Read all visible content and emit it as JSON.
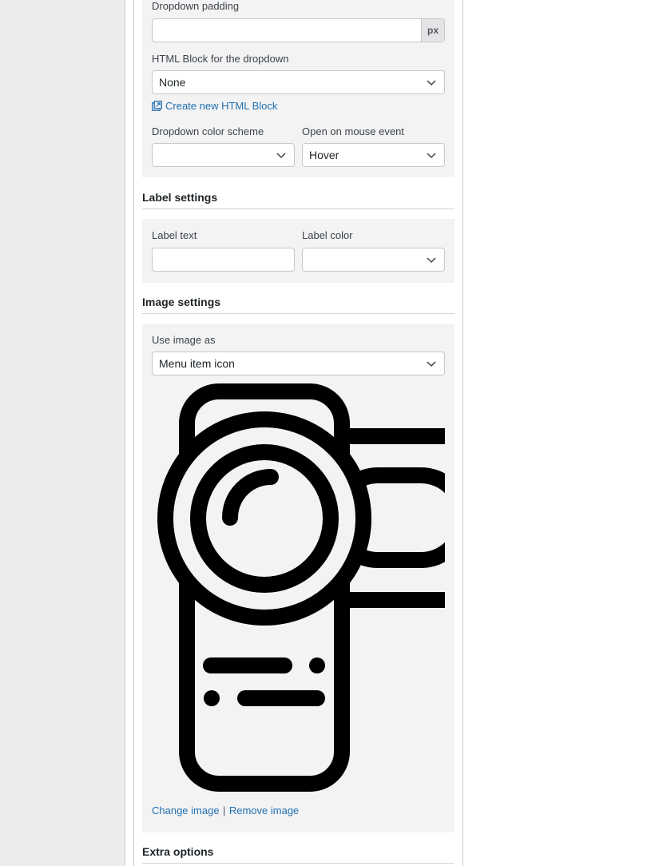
{
  "menu": {
    "dropdown_padding": {
      "label": "Dropdown padding",
      "value": "",
      "unit": "px"
    },
    "html_block": {
      "label": "HTML Block for the dropdown",
      "selected": "None",
      "create_link": "Create new HTML Block"
    },
    "color_scheme": {
      "label": "Dropdown color scheme",
      "selected": ""
    },
    "mouse_event": {
      "label": "Open on mouse event",
      "selected": "Hover"
    }
  },
  "label_settings": {
    "title": "Label settings",
    "label_text": {
      "label": "Label text",
      "value": ""
    },
    "label_color": {
      "label": "Label color",
      "selected": ""
    }
  },
  "image_settings": {
    "title": "Image settings",
    "use_image_as": {
      "label": "Use image as",
      "selected": "Menu item icon"
    },
    "preview_icon": "video-camera-icon",
    "change_image": "Change image",
    "separator": "|",
    "remove_image": "Remove image"
  },
  "extra_options": {
    "title": "Extra options"
  },
  "colors": {
    "link": "#2271b1",
    "panel_bg": "#f3f3f4",
    "sidebar_bg": "#ececee",
    "border": "#c7c7cc"
  }
}
